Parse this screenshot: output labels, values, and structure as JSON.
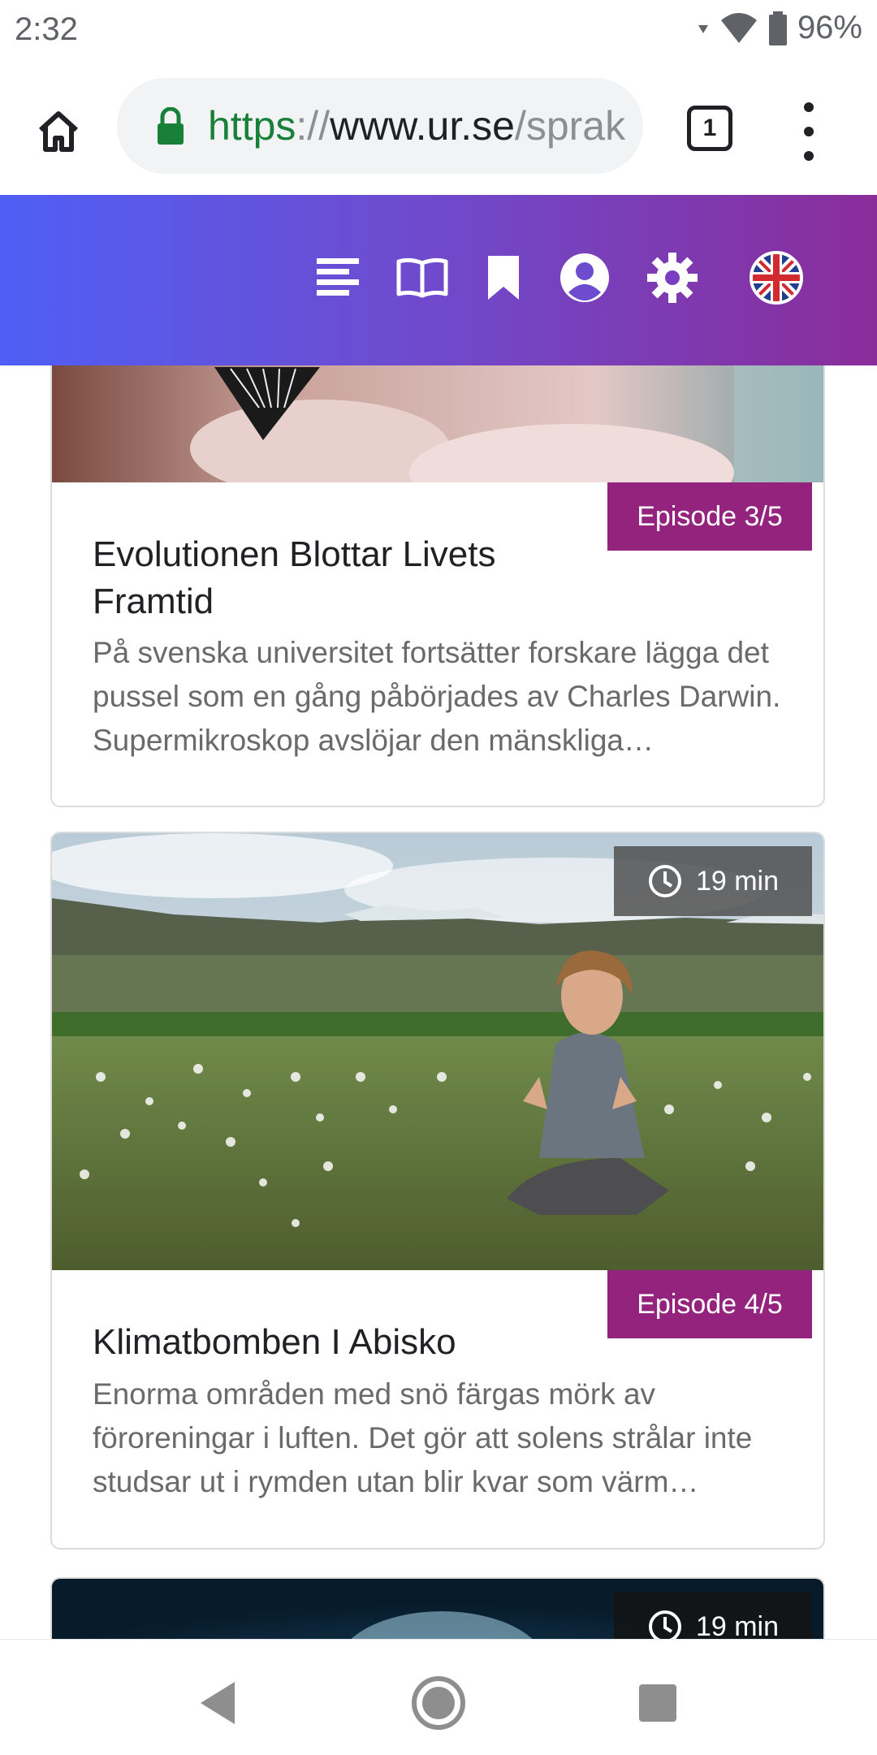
{
  "status_bar": {
    "time": "2:32",
    "battery": "96%",
    "icons": [
      "wifi-icon",
      "signal-icon",
      "battery-icon"
    ]
  },
  "browser": {
    "url_scheme": "https",
    "url_sep": "://",
    "url_host": "www.ur.se",
    "url_path": "/sprak",
    "tab_count": "1",
    "icons": [
      "home-icon",
      "lock-icon",
      "overflow-menu-icon"
    ]
  },
  "site_header": {
    "icons": [
      "text-lines-icon",
      "book-icon",
      "bookmark-icon",
      "account-icon",
      "settings-gear-icon",
      "uk-flag-icon"
    ]
  },
  "episodes": [
    {
      "badge": "Episode 3/5",
      "title": "Evolutionen Blottar Livets Framtid",
      "description": "På svenska universitet fortsätter forskare lägga det pussel som en gång påbörjades av Charles Darwin. Supermikroskop avslöjar den mänskliga…"
    },
    {
      "duration": "19 min",
      "badge": "Episode 4/5",
      "title": "Klimatbomben I Abisko",
      "description": "Enorma områden med snö färgas mörk av föroreningar i luften. Det gör att solens strålar inte studsar ut i rymden utan blir kvar som värm…"
    },
    {
      "duration": "19 min"
    }
  ],
  "colors": {
    "header_gradient_start": "#4f5ff5",
    "header_gradient_end": "#8a2d9a",
    "episode_badge": "#94237e",
    "url_scheme": "#188038"
  },
  "nav_bar": {
    "icons": [
      "back-icon",
      "home-circle-icon",
      "recents-icon"
    ]
  }
}
